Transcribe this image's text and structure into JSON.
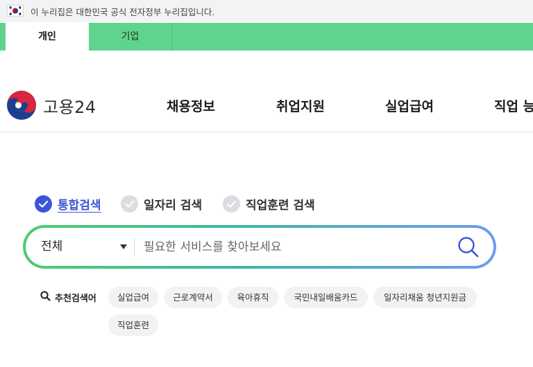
{
  "gov_banner": {
    "text": "이 누리집은 대한민국 공식 전자정부 누리집입니다."
  },
  "user_tabs": [
    {
      "label": "개인",
      "active": true
    },
    {
      "label": "기업",
      "active": false
    }
  ],
  "logo": {
    "text": "고용24"
  },
  "nav": {
    "items": [
      {
        "label": "채용정보"
      },
      {
        "label": "취업지원"
      },
      {
        "label": "실업급여"
      },
      {
        "label": "직업 능"
      }
    ]
  },
  "search": {
    "types": [
      {
        "label": "통합검색",
        "active": true
      },
      {
        "label": "일자리 검색",
        "active": false
      },
      {
        "label": "직업훈련 검색",
        "active": false
      }
    ],
    "scope_value": "전체",
    "placeholder": "필요한 서비스를 찾아보세요",
    "value": ""
  },
  "recommend": {
    "label": "추천검색어",
    "keywords": [
      "실업급여",
      "근로계약서",
      "육아휴직",
      "국민내일배움카드",
      "일자리채움 청년지원금",
      "직업훈련"
    ]
  },
  "colors": {
    "tab_bar": "#5fd48e",
    "accent": "#3a55d6",
    "gradient_start": "#4fcb6a",
    "gradient_end": "#6f9bf0"
  }
}
